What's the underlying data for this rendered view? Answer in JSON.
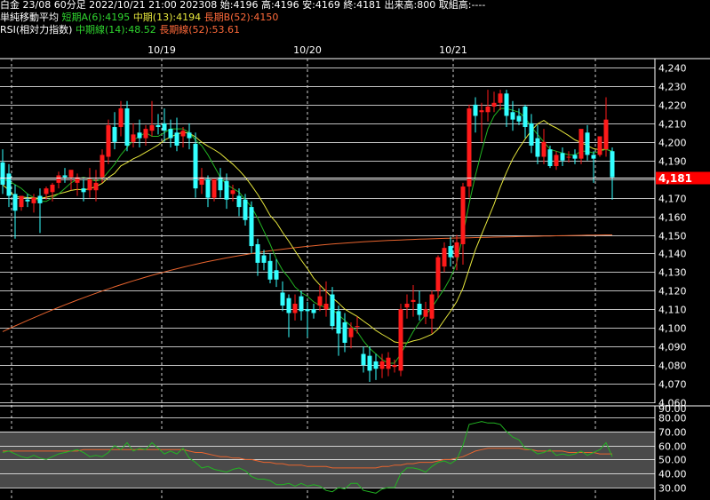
{
  "header": {
    "line1": "白金 23/08 60分足 2022/10/21 21:00 202308 始:4196 高:4196 安:4169 終:4181 出来高:800 取組高:----",
    "ma_title": "単純移動平均",
    "ma_short": "短期A(6):4195",
    "ma_mid": "中期(13):4194",
    "ma_long": "長期B(52):4150",
    "rsi_title": "RSI(相対力指数)",
    "rsi_mid": "中期線(14):48.52",
    "rsi_long": "長期線(52):53.61"
  },
  "colors": {
    "up": "#ff1a1a",
    "down": "#33ffff",
    "ma_short": "#22b422",
    "ma_mid": "#e6e63c",
    "ma_long": "#e8642e",
    "last_price_bg": "#ff0000"
  },
  "chart_data": [
    {
      "type": "candlestick",
      "title": "",
      "x_labels": [
        "10/19",
        "10/20",
        "10/21"
      ],
      "ylim": [
        4060,
        4240
      ],
      "y_ticks": [
        4060,
        4070,
        4080,
        4090,
        4100,
        4110,
        4120,
        4130,
        4140,
        4150,
        4160,
        4170,
        4180,
        4190,
        4200,
        4210,
        4220,
        4230,
        4240
      ],
      "y_tick_labels": [
        "4,060",
        "4,070",
        "4,080",
        "4,090",
        "4,100",
        "4,110",
        "4,120",
        "4,130",
        "4,140",
        "4,150",
        "4,160",
        "4,170",
        "4,180",
        "4,190",
        "4,200",
        "4,210",
        "4,220",
        "4,230",
        "4,240"
      ],
      "last_price": 4181,
      "last_price_label": "4,181",
      "candles": [
        {
          "o": 4189,
          "h": 4196,
          "c": 4177,
          "l": 4172
        },
        {
          "o": 4183,
          "h": 4188,
          "c": 4171,
          "l": 4165
        },
        {
          "o": 4172,
          "h": 4177,
          "c": 4163,
          "l": 4148
        },
        {
          "o": 4165,
          "h": 4170,
          "c": 4171,
          "l": 4163
        },
        {
          "o": 4169,
          "h": 4172,
          "c": 4168,
          "l": 4165
        },
        {
          "o": 4167,
          "h": 4172,
          "c": 4170,
          "l": 4162
        },
        {
          "o": 4171,
          "h": 4175,
          "c": 4167,
          "l": 4151
        },
        {
          "o": 4172,
          "h": 4176,
          "c": 4175,
          "l": 4169
        },
        {
          "o": 4173,
          "h": 4178,
          "c": 4177,
          "l": 4168
        },
        {
          "o": 4178,
          "h": 4184,
          "c": 4182,
          "l": 4175
        },
        {
          "o": 4182,
          "h": 4186,
          "c": 4181,
          "l": 4178
        },
        {
          "o": 4181,
          "h": 4183,
          "c": 4185,
          "l": 4174
        },
        {
          "o": 4178,
          "h": 4183,
          "c": 4181,
          "l": 4171
        },
        {
          "o": 4175,
          "h": 4180,
          "c": 4173,
          "l": 4168
        },
        {
          "o": 4174,
          "h": 4186,
          "c": 4180,
          "l": 4170
        },
        {
          "o": 4174,
          "h": 4185,
          "c": 4178,
          "l": 4168
        },
        {
          "o": 4181,
          "h": 4196,
          "c": 4193,
          "l": 4178
        },
        {
          "o": 4192,
          "h": 4212,
          "c": 4209,
          "l": 4188
        },
        {
          "o": 4208,
          "h": 4216,
          "c": 4200,
          "l": 4196
        },
        {
          "o": 4208,
          "h": 4222,
          "c": 4218,
          "l": 4203
        },
        {
          "o": 4218,
          "h": 4222,
          "c": 4198,
          "l": 4195
        },
        {
          "o": 4200,
          "h": 4210,
          "c": 4204,
          "l": 4197
        },
        {
          "o": 4205,
          "h": 4212,
          "c": 4202,
          "l": 4197
        },
        {
          "o": 4202,
          "h": 4209,
          "c": 4207,
          "l": 4198
        },
        {
          "o": 4206,
          "h": 4222,
          "c": 4209,
          "l": 4203
        },
        {
          "o": 4209,
          "h": 4215,
          "c": 4208,
          "l": 4204
        },
        {
          "o": 4210,
          "h": 4218,
          "c": 4206,
          "l": 4200
        },
        {
          "o": 4207,
          "h": 4212,
          "c": 4202,
          "l": 4197
        },
        {
          "o": 4205,
          "h": 4213,
          "c": 4198,
          "l": 4195
        },
        {
          "o": 4203,
          "h": 4208,
          "c": 4206,
          "l": 4197
        },
        {
          "o": 4205,
          "h": 4210,
          "c": 4202,
          "l": 4196
        },
        {
          "o": 4199,
          "h": 4205,
          "c": 4175,
          "l": 4170
        },
        {
          "o": 4177,
          "h": 4186,
          "c": 4181,
          "l": 4172
        },
        {
          "o": 4180,
          "h": 4182,
          "c": 4170,
          "l": 4165
        },
        {
          "o": 4170,
          "h": 4178,
          "c": 4180,
          "l": 4168
        },
        {
          "o": 4181,
          "h": 4186,
          "c": 4174,
          "l": 4170
        },
        {
          "o": 4179,
          "h": 4183,
          "c": 4169,
          "l": 4164
        },
        {
          "o": 4172,
          "h": 4177,
          "c": 4174,
          "l": 4168
        },
        {
          "o": 4171,
          "h": 4175,
          "c": 4165,
          "l": 4160
        },
        {
          "o": 4169,
          "h": 4172,
          "c": 4158,
          "l": 4155
        },
        {
          "o": 4165,
          "h": 4168,
          "c": 4144,
          "l": 4140
        },
        {
          "o": 4145,
          "h": 4148,
          "c": 4135,
          "l": 4128
        },
        {
          "o": 4139,
          "h": 4142,
          "c": 4135,
          "l": 4131
        },
        {
          "o": 4136,
          "h": 4140,
          "c": 4126,
          "l": 4124
        },
        {
          "o": 4131,
          "h": 4137,
          "c": 4126,
          "l": 4122
        },
        {
          "o": 4119,
          "h": 4125,
          "c": 4112,
          "l": 4109
        },
        {
          "o": 4116,
          "h": 4118,
          "c": 4108,
          "l": 4095
        },
        {
          "o": 4108,
          "h": 4118,
          "c": 4113,
          "l": 4104
        },
        {
          "o": 4117,
          "h": 4120,
          "c": 4109,
          "l": 4104
        },
        {
          "o": 4110,
          "h": 4114,
          "c": 4109,
          "l": 4095
        },
        {
          "o": 4110,
          "h": 4113,
          "c": 4108,
          "l": 4105
        },
        {
          "o": 4112,
          "h": 4123,
          "c": 4117,
          "l": 4109
        },
        {
          "o": 4110,
          "h": 4125,
          "c": 4113,
          "l": 4106
        },
        {
          "o": 4118,
          "h": 4122,
          "c": 4101,
          "l": 4099
        },
        {
          "o": 4109,
          "h": 4112,
          "c": 4097,
          "l": 4085
        },
        {
          "o": 4103,
          "h": 4108,
          "c": 4092,
          "l": 4087
        },
        {
          "o": 4095,
          "h": 4103,
          "c": 4100,
          "l": 4089
        },
        {
          "o": 4101,
          "h": 4106,
          "c": 4101,
          "l": 4097
        },
        {
          "o": 4086,
          "h": 4090,
          "c": 4080,
          "l": 4076
        },
        {
          "o": 4085,
          "h": 4090,
          "c": 4077,
          "l": 4071
        },
        {
          "o": 4082,
          "h": 4086,
          "c": 4078,
          "l": 4072
        },
        {
          "o": 4078,
          "h": 4086,
          "c": 4082,
          "l": 4073
        },
        {
          "o": 4078,
          "h": 4087,
          "c": 4084,
          "l": 4074
        },
        {
          "o": 4079,
          "h": 4083,
          "c": 4080,
          "l": 4076
        },
        {
          "o": 4077,
          "h": 4113,
          "c": 4110,
          "l": 4074
        },
        {
          "o": 4111,
          "h": 4118,
          "c": 4113,
          "l": 4105
        },
        {
          "o": 4114,
          "h": 4123,
          "c": 4115,
          "l": 4106
        },
        {
          "o": 4113,
          "h": 4120,
          "c": 4107,
          "l": 4104
        },
        {
          "o": 4106,
          "h": 4114,
          "c": 4110,
          "l": 4102
        },
        {
          "o": 4105,
          "h": 4120,
          "c": 4118,
          "l": 4097
        },
        {
          "o": 4120,
          "h": 4139,
          "c": 4138,
          "l": 4116
        },
        {
          "o": 4133,
          "h": 4146,
          "c": 4143,
          "l": 4130
        },
        {
          "o": 4144,
          "h": 4149,
          "c": 4138,
          "l": 4133
        },
        {
          "o": 4138,
          "h": 4150,
          "c": 4146,
          "l": 4131
        },
        {
          "o": 4145,
          "h": 4178,
          "c": 4176,
          "l": 4134
        },
        {
          "o": 4176,
          "h": 4220,
          "c": 4218,
          "l": 4170
        },
        {
          "o": 4220,
          "h": 4224,
          "c": 4214,
          "l": 4205
        },
        {
          "o": 4216,
          "h": 4221,
          "c": 4217,
          "l": 4200
        },
        {
          "o": 4216,
          "h": 4228,
          "c": 4219,
          "l": 4211
        },
        {
          "o": 4219,
          "h": 4227,
          "c": 4221,
          "l": 4216
        },
        {
          "o": 4221,
          "h": 4228,
          "c": 4226,
          "l": 4217
        },
        {
          "o": 4226,
          "h": 4228,
          "c": 4214,
          "l": 4208
        },
        {
          "o": 4216,
          "h": 4222,
          "c": 4212,
          "l": 4206
        },
        {
          "o": 4214,
          "h": 4218,
          "c": 4211,
          "l": 4209
        },
        {
          "o": 4219,
          "h": 4220,
          "c": 4208,
          "l": 4202
        },
        {
          "o": 4210,
          "h": 4215,
          "c": 4198,
          "l": 4194
        },
        {
          "o": 4202,
          "h": 4209,
          "c": 4192,
          "l": 4188
        },
        {
          "o": 4192,
          "h": 4207,
          "c": 4200,
          "l": 4188
        },
        {
          "o": 4196,
          "h": 4198,
          "c": 4187,
          "l": 4186
        },
        {
          "o": 4187,
          "h": 4195,
          "c": 4193,
          "l": 4185
        },
        {
          "o": 4194,
          "h": 4197,
          "c": 4190,
          "l": 4187
        },
        {
          "o": 4192,
          "h": 4195,
          "c": 4192,
          "l": 4189
        },
        {
          "o": 4193,
          "h": 4196,
          "c": 4191,
          "l": 4188
        },
        {
          "o": 4191,
          "h": 4205,
          "c": 4207,
          "l": 4188
        },
        {
          "o": 4205,
          "h": 4209,
          "c": 4193,
          "l": 4190
        },
        {
          "o": 4193,
          "h": 4195,
          "c": 4191,
          "l": 4178
        },
        {
          "o": 4193,
          "h": 4197,
          "c": 4203,
          "l": 4192
        },
        {
          "o": 4196,
          "h": 4224,
          "c": 4212,
          "l": 4192
        },
        {
          "o": 4195,
          "h": 4197,
          "c": 4181,
          "l": 4169
        }
      ]
    },
    {
      "type": "line",
      "title": "",
      "ylim": [
        20,
        90
      ],
      "y_ticks": [
        30,
        40,
        50,
        60,
        70,
        80
      ],
      "y_tick_labels": [
        "30.00",
        "40.00",
        "50.00",
        "60.00",
        "70.00",
        "80.00"
      ],
      "top_tick_label": "90.00",
      "series": [
        {
          "values": [
            55,
            56,
            54,
            52,
            51,
            53,
            51,
            50,
            52,
            54,
            55,
            56,
            57,
            55,
            52,
            53,
            52,
            55,
            60,
            57,
            62,
            56,
            58,
            57,
            62,
            58,
            54,
            56,
            54,
            58,
            51,
            48,
            44,
            45,
            43,
            42,
            41,
            43,
            44,
            42,
            38,
            36,
            36,
            35,
            32,
            32,
            33,
            31,
            33,
            31,
            32,
            31,
            28,
            27,
            30,
            29,
            33,
            33,
            28,
            27,
            26,
            29,
            30,
            30,
            40,
            44,
            44,
            43,
            41,
            45,
            48,
            49,
            47,
            50,
            60,
            75,
            76,
            77,
            76,
            76,
            75,
            70,
            66,
            64,
            58,
            57,
            54,
            55,
            57,
            53,
            54,
            53,
            54,
            56,
            53,
            55,
            57,
            62,
            52
          ]
        },
        {
          "values": [
            56,
            56,
            56,
            56,
            56,
            56,
            56,
            56,
            56,
            56,
            56,
            56,
            56,
            57,
            57,
            57,
            57,
            57,
            57,
            57,
            57,
            57,
            57,
            57,
            57,
            57,
            57,
            57,
            57,
            57,
            56,
            55,
            55,
            54,
            53,
            52,
            52,
            51,
            51,
            50,
            50,
            49,
            48,
            48,
            47,
            47,
            46,
            46,
            46,
            45,
            45,
            45,
            45,
            44,
            44,
            44,
            44,
            44,
            44,
            44,
            44,
            45,
            45,
            46,
            46,
            47,
            47,
            48,
            48,
            48,
            49,
            50,
            50,
            51,
            52,
            54,
            56,
            57,
            58,
            58,
            58,
            58,
            58,
            58,
            57,
            57,
            56,
            56,
            56,
            56,
            56,
            55,
            55,
            55,
            55,
            55,
            54,
            54,
            54
          ]
        }
      ]
    }
  ],
  "overlays": {
    "ma_short": [
      4180,
      4179,
      4177,
      4175,
      4172,
      4170,
      4168,
      4168,
      4170,
      4172,
      4175,
      4178,
      4180,
      4181,
      4180,
      4179,
      4180,
      4184,
      4188,
      4193,
      4197,
      4201,
      4203,
      4205,
      4203,
      4203,
      4205,
      4207,
      4207,
      4207,
      4205,
      4201,
      4198,
      4193,
      4187,
      4181,
      4177,
      4175,
      4173,
      4169,
      4165,
      4159,
      4152,
      4145,
      4137,
      4131,
      4127,
      4122,
      4119,
      4117,
      4114,
      4112,
      4111,
      4110,
      4107,
      4104,
      4101,
      4098,
      4093,
      4089,
      4086,
      4083,
      4081,
      4081,
      4086,
      4092,
      4098,
      4103,
      4107,
      4111,
      4116,
      4121,
      4127,
      4135,
      4150,
      4167,
      4182,
      4195,
      4207,
      4214,
      4218,
      4218,
      4217,
      4216,
      4213,
      4208,
      4204,
      4200,
      4196,
      4195,
      4194,
      4193,
      4193,
      4195,
      4195,
      4194,
      4195,
      4196,
      4195
    ]
  }
}
